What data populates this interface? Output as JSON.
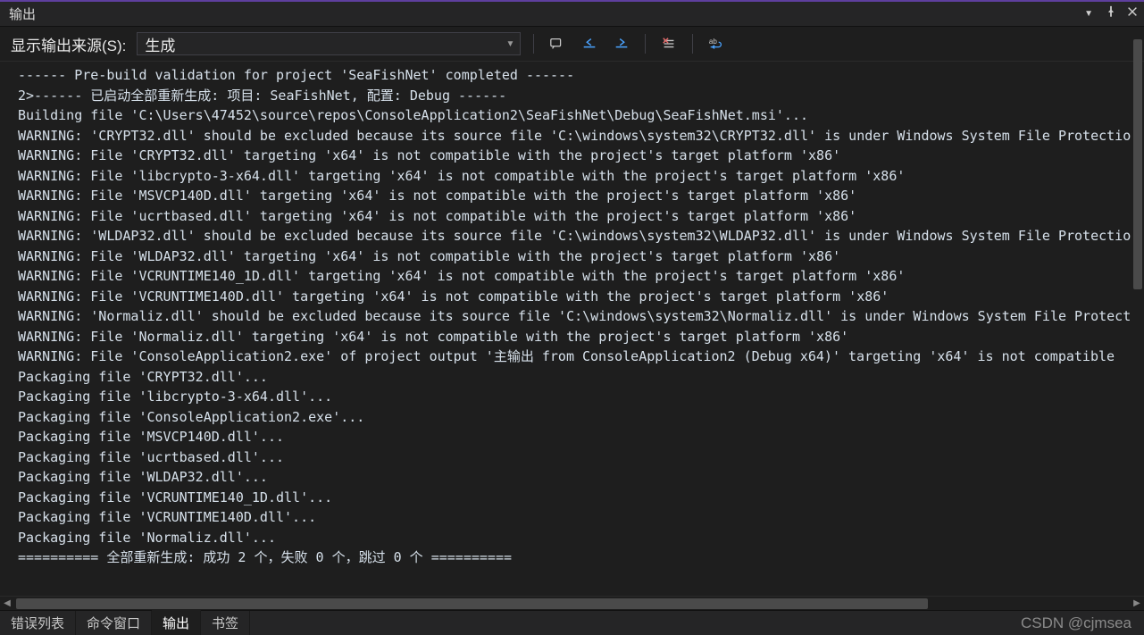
{
  "header": {
    "title": "输出"
  },
  "toolbar": {
    "source_label": "显示输出来源(S):",
    "source_value": "生成"
  },
  "output_lines": [
    "------ Pre-build validation for project 'SeaFishNet' completed ------",
    "2>------ 已启动全部重新生成: 项目: SeaFishNet, 配置: Debug ------",
    "Building file 'C:\\Users\\47452\\source\\repos\\ConsoleApplication2\\SeaFishNet\\Debug\\SeaFishNet.msi'...",
    "WARNING: 'CRYPT32.dll' should be excluded because its source file 'C:\\windows\\system32\\CRYPT32.dll' is under Windows System File Protectio",
    "WARNING: File 'CRYPT32.dll' targeting 'x64' is not compatible with the project's target platform 'x86'",
    "WARNING: File 'libcrypto-3-x64.dll' targeting 'x64' is not compatible with the project's target platform 'x86'",
    "WARNING: File 'MSVCP140D.dll' targeting 'x64' is not compatible with the project's target platform 'x86'",
    "WARNING: File 'ucrtbased.dll' targeting 'x64' is not compatible with the project's target platform 'x86'",
    "WARNING: 'WLDAP32.dll' should be excluded because its source file 'C:\\windows\\system32\\WLDAP32.dll' is under Windows System File Protectio",
    "WARNING: File 'WLDAP32.dll' targeting 'x64' is not compatible with the project's target platform 'x86'",
    "WARNING: File 'VCRUNTIME140_1D.dll' targeting 'x64' is not compatible with the project's target platform 'x86'",
    "WARNING: File 'VCRUNTIME140D.dll' targeting 'x64' is not compatible with the project's target platform 'x86'",
    "WARNING: 'Normaliz.dll' should be excluded because its source file 'C:\\windows\\system32\\Normaliz.dll' is under Windows System File Protect",
    "WARNING: File 'Normaliz.dll' targeting 'x64' is not compatible with the project's target platform 'x86'",
    "WARNING: File 'ConsoleApplication2.exe' of project output '主输出 from ConsoleApplication2 (Debug x64)' targeting 'x64' is not compatible ",
    "Packaging file 'CRYPT32.dll'...",
    "Packaging file 'libcrypto-3-x64.dll'...",
    "Packaging file 'ConsoleApplication2.exe'...",
    "Packaging file 'MSVCP140D.dll'...",
    "Packaging file 'ucrtbased.dll'...",
    "Packaging file 'WLDAP32.dll'...",
    "Packaging file 'VCRUNTIME140_1D.dll'...",
    "Packaging file 'VCRUNTIME140D.dll'...",
    "Packaging file 'Normaliz.dll'...",
    "========== 全部重新生成: 成功 2 个，失败 0 个，跳过 0 个 =========="
  ],
  "tabs": {
    "error_list": "错误列表",
    "command_window": "命令窗口",
    "output": "输出",
    "bookmarks": "书签"
  },
  "watermark": "CSDN @cjmsea"
}
